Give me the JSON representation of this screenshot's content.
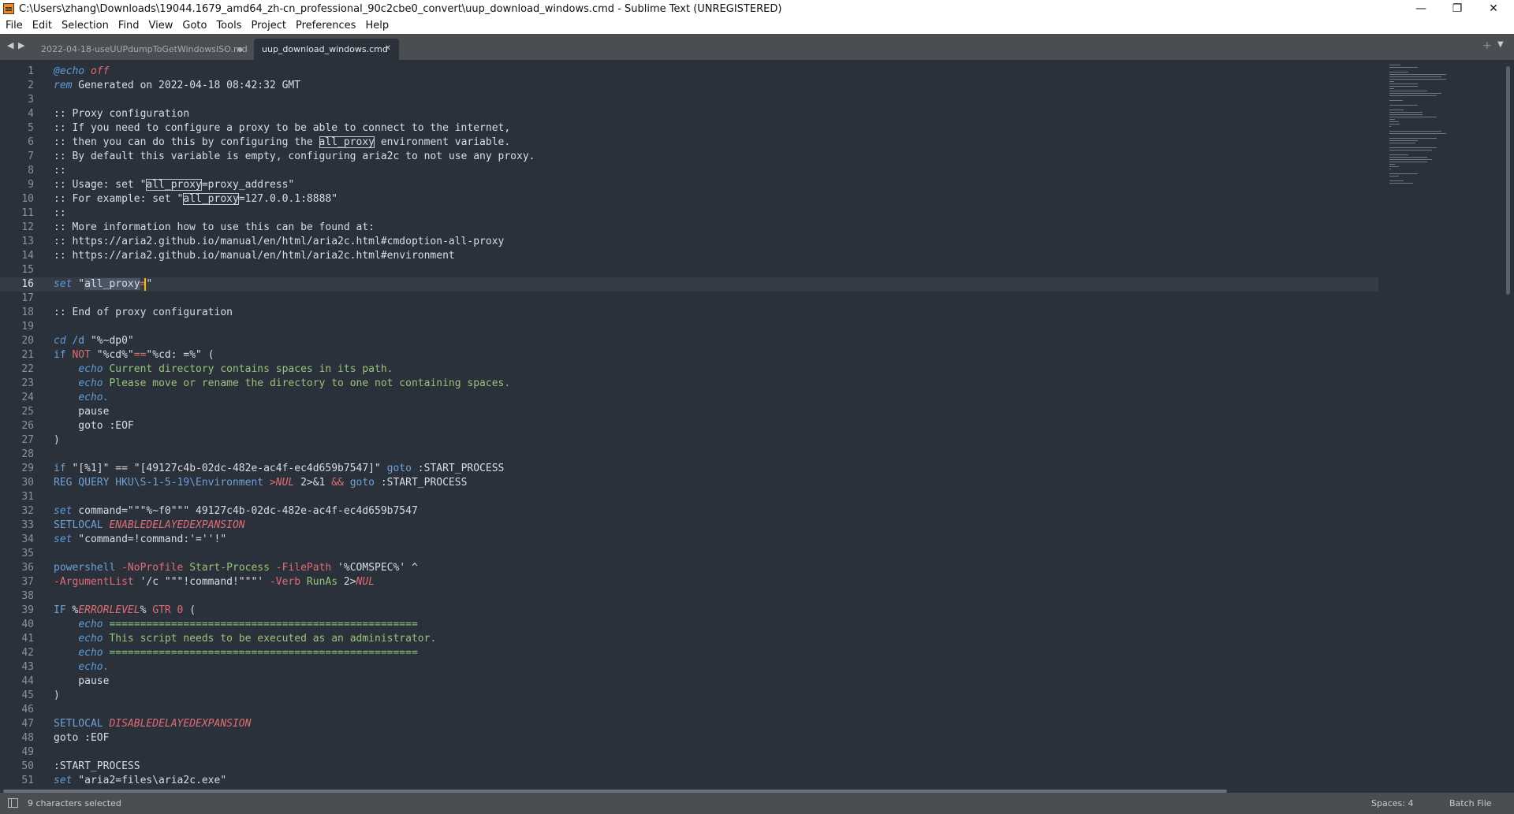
{
  "window": {
    "title": "C:\\Users\\zhang\\Downloads\\19044.1679_amd64_zh-cn_professional_90c2cbe0_convert\\uup_download_windows.cmd - Sublime Text (UNREGISTERED)",
    "controls": [
      "—",
      "❐",
      "✕"
    ]
  },
  "menu": [
    "File",
    "Edit",
    "Selection",
    "Find",
    "View",
    "Goto",
    "Tools",
    "Project",
    "Preferences",
    "Help"
  ],
  "tabs": [
    {
      "label": "2022-04-18-useUUPdumpToGetWindowsISO.md",
      "mark": "●",
      "active": false
    },
    {
      "label": "uup_download_windows.cmd",
      "mark": "✕",
      "active": true
    }
  ],
  "tabbar_icons": {
    "left": "◀",
    "right": "▶",
    "plus": "+",
    "dropdown": "▼"
  },
  "editor": {
    "current_line": 16,
    "lines": [
      [
        [
          "@echo",
          "key"
        ],
        [
          " off",
          "red"
        ]
      ],
      [
        [
          "rem",
          "key"
        ],
        [
          " Generated on 2022-04-18 08:42:32 GMT",
          "sym"
        ]
      ],
      [],
      [
        [
          ":: Proxy configuration",
          "sym"
        ]
      ],
      [
        [
          ":: If you need to configure a proxy to be able to connect to the internet,",
          "sym"
        ]
      ],
      [
        [
          ":: then you can do this by configuring the ",
          "sym"
        ],
        [
          "all_proxy",
          "box"
        ],
        [
          " environment variable.",
          "sym"
        ]
      ],
      [
        [
          ":: By default this variable is empty, configuring aria2c to not use any proxy.",
          "sym"
        ]
      ],
      [
        [
          "::",
          "sym"
        ]
      ],
      [
        [
          ":: Usage: set \"",
          "sym"
        ],
        [
          "all_proxy",
          "box"
        ],
        [
          "=proxy_address\"",
          "sym"
        ]
      ],
      [
        [
          ":: For example: set \"",
          "sym"
        ],
        [
          "all_proxy",
          "box"
        ],
        [
          "=127.0.0.1:8888\"",
          "sym"
        ]
      ],
      [
        [
          "::",
          "sym"
        ]
      ],
      [
        [
          ":: More information how to use this can be found at:",
          "sym"
        ]
      ],
      [
        [
          ":: https://aria2.github.io/manual/en/html/aria2c.html#cmdoption-all-proxy",
          "sym"
        ]
      ],
      [
        [
          ":: https://aria2.github.io/manual/en/html/aria2c.html#environment",
          "sym"
        ]
      ],
      [],
      [
        [
          "set",
          "key"
        ],
        [
          " \"",
          "sym"
        ],
        [
          "all_proxy",
          "sel"
        ],
        [
          "=",
          "op"
        ],
        [
          "\"",
          "sym"
        ]
      ],
      [],
      [
        [
          ":: End of proxy configuration",
          "sym"
        ]
      ],
      [],
      [
        [
          "cd",
          "key"
        ],
        [
          " /d ",
          "cmd"
        ],
        [
          "\"%~dp0\"",
          "sym"
        ]
      ],
      [
        [
          "if",
          "cmd"
        ],
        [
          " NOT",
          "op"
        ],
        [
          " \"%cd%\"",
          "sym"
        ],
        [
          "==",
          "op"
        ],
        [
          "\"%cd: =%\"",
          "sym"
        ],
        [
          " (",
          "sym"
        ]
      ],
      [
        [
          "    "
        ],
        [
          "echo",
          "key"
        ],
        [
          " Current directory contains spaces in its path.",
          "str"
        ]
      ],
      [
        [
          "    "
        ],
        [
          "echo",
          "key"
        ],
        [
          " Please move or rename the directory to one not containing spaces.",
          "str"
        ]
      ],
      [
        [
          "    "
        ],
        [
          "echo.",
          "key"
        ]
      ],
      [
        [
          "    pause",
          "sym"
        ]
      ],
      [
        [
          "    goto :EOF",
          "sym"
        ]
      ],
      [
        [
          ")",
          "sym"
        ]
      ],
      [],
      [
        [
          "if",
          "cmd"
        ],
        [
          " \"[%1]\" == \"[49127c4b-02dc-482e-ac4f-ec4d659b7547]\"",
          "sym"
        ],
        [
          " goto",
          "cmd"
        ],
        [
          " :START_PROCESS",
          "sym"
        ]
      ],
      [
        [
          "REG QUERY HKU\\S-1-5-19\\Environment",
          "cmd"
        ],
        [
          " >NUL",
          "red"
        ],
        [
          " 2>&1",
          "sym"
        ],
        [
          " &&",
          "op"
        ],
        [
          " goto",
          "cmd"
        ],
        [
          " :START_PROCESS",
          "sym"
        ]
      ],
      [],
      [
        [
          "set",
          "key"
        ],
        [
          " command=\"\"\"%~f0\"\"\" 49127c4b-02dc-482e-ac4f-ec4d659b7547",
          "sym"
        ]
      ],
      [
        [
          "SETLOCAL",
          "cmd"
        ],
        [
          " ENABLEDELAYEDEXPANSION",
          "red"
        ]
      ],
      [
        [
          "set",
          "key"
        ],
        [
          " \"command=!command:'=''!\"",
          "sym"
        ]
      ],
      [],
      [
        [
          "powershell",
          "cmd"
        ],
        [
          " -NoProfile",
          "op"
        ],
        [
          " Start-Process",
          "str"
        ],
        [
          " -FilePath",
          "op"
        ],
        [
          " '%COMSPEC%' ^",
          "sym"
        ]
      ],
      [
        [
          "-ArgumentList",
          "op"
        ],
        [
          " '/c \"\"\"!command!\"\"\"'",
          "sym"
        ],
        [
          " -Verb",
          "op"
        ],
        [
          " RunAs",
          "str"
        ],
        [
          " 2>",
          "sym"
        ],
        [
          "NUL",
          "red"
        ]
      ],
      [],
      [
        [
          "IF",
          "cmd"
        ],
        [
          " %",
          "sym"
        ],
        [
          "ERRORLEVEL",
          "red"
        ],
        [
          "%",
          "sym"
        ],
        [
          " GTR 0",
          "op"
        ],
        [
          " (",
          "sym"
        ]
      ],
      [
        [
          "    "
        ],
        [
          "echo",
          "key"
        ],
        [
          " ==================================================",
          "str"
        ]
      ],
      [
        [
          "    "
        ],
        [
          "echo",
          "key"
        ],
        [
          " This script needs to be executed as an administrator.",
          "str"
        ]
      ],
      [
        [
          "    "
        ],
        [
          "echo",
          "key"
        ],
        [
          " ==================================================",
          "str"
        ]
      ],
      [
        [
          "    "
        ],
        [
          "echo.",
          "key"
        ]
      ],
      [
        [
          "    pause",
          "sym"
        ]
      ],
      [
        [
          ")",
          "sym"
        ]
      ],
      [],
      [
        [
          "SETLOCAL",
          "cmd"
        ],
        [
          " DISABLEDELAYEDEXPANSION",
          "red"
        ]
      ],
      [
        [
          "goto :EOF",
          "sym"
        ]
      ],
      [],
      [
        [
          ":START_PROCESS",
          "sym"
        ]
      ],
      [
        [
          "set",
          "key"
        ],
        [
          " \"aria2=files\\aria2c.exe\"",
          "sym"
        ]
      ]
    ]
  },
  "status": {
    "selection": "9 characters selected",
    "spaces": "Spaces: 4",
    "syntax": "Batch File"
  }
}
